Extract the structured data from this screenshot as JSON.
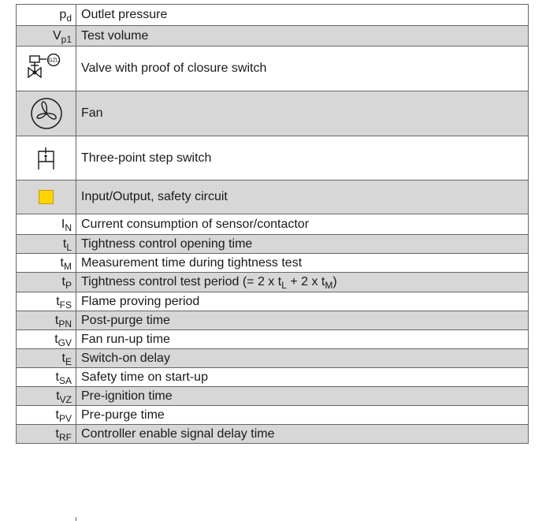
{
  "rows": [
    {
      "main": "p",
      "sub": "d",
      "desc": "Outlet pressure"
    },
    {
      "main": "V",
      "sub": "p1",
      "desc": "Test volume"
    },
    {
      "icon": "valve-with-proof-of-closure-switch-icon",
      "icon_text": "GZL",
      "desc": "Valve with proof of closure switch"
    },
    {
      "icon": "fan-icon",
      "desc": "Fan"
    },
    {
      "icon": "three-point-step-switch-icon",
      "desc": "Three-point step switch"
    },
    {
      "icon": "safety-circuit-yellow-box-icon",
      "icon_color": "#ffd400",
      "desc": "Input/Output, safety circuit"
    },
    {
      "main": "I",
      "sub": "N",
      "desc": "Current consumption of sensor/contactor"
    },
    {
      "main": "t",
      "sub": "L",
      "desc": "Tightness control opening time"
    },
    {
      "main": "t",
      "sub": "M",
      "desc": "Measurement time during tightness test"
    },
    {
      "main": "t",
      "sub": "P",
      "desc_parts": [
        "Tightness control test period (= 2 x t",
        "L",
        " + 2 x t",
        "M",
        ")"
      ]
    },
    {
      "main": "t",
      "sub": "FS",
      "desc": "Flame proving period"
    },
    {
      "main": "t",
      "sub": "PN",
      "desc": "Post-purge time"
    },
    {
      "main": "t",
      "sub": "GV",
      "desc": "Fan run-up time"
    },
    {
      "main": "t",
      "sub": "E",
      "desc": "Switch-on delay"
    },
    {
      "main": "t",
      "sub": "SA",
      "desc": "Safety time on start-up"
    },
    {
      "main": "t",
      "sub": "VZ",
      "desc": "Pre-ignition time"
    },
    {
      "main": "t",
      "sub": "PV",
      "desc": "Pre-purge time"
    },
    {
      "main": "t",
      "sub": "RF",
      "desc": "Controller enable signal delay time"
    }
  ],
  "colors": {
    "shaded_row": "#d7d7d7",
    "border": "#666666",
    "safety_circuit": "#ffd400"
  }
}
